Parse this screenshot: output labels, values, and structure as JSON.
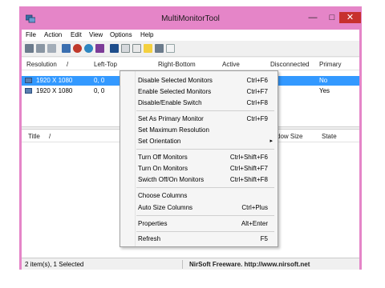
{
  "window": {
    "title": "MultiMonitorTool",
    "accent": "#e585c8",
    "controls": [
      "—",
      "□",
      "✕"
    ]
  },
  "menu": [
    "File",
    "Action",
    "Edit",
    "View",
    "Options",
    "Help"
  ],
  "table": {
    "headers": [
      "Resolution",
      "/",
      "Left-Top",
      "Right-Bottom",
      "Active",
      "Disconnected",
      "Primary"
    ],
    "rows": [
      {
        "resolution": "1920 X 1080",
        "left_top": "0, 0",
        "primary": "No",
        "selected": true
      },
      {
        "resolution": "1920 X 1080",
        "left_top": "0, 0",
        "primary": "Yes",
        "selected": false
      }
    ]
  },
  "lower_table": {
    "headers": [
      "Title",
      "/",
      "dow Size",
      "State"
    ]
  },
  "context_menu": {
    "items": [
      {
        "label": "Disable Selected Monitors",
        "key": "Ctrl+F6"
      },
      {
        "label": "Enable Selected Monitors",
        "key": "Ctrl+F7"
      },
      {
        "label": "Disable/Enable Switch",
        "key": "Ctrl+F8"
      },
      {
        "label": "Set As Primary Monitor",
        "key": "Ctrl+F9"
      },
      {
        "label": "Set Maximum Resolution",
        "key": ""
      },
      {
        "label": "Set Orientation",
        "key": ""
      },
      {
        "label": "Turn Off Monitors",
        "key": "Ctrl+Shift+F6"
      },
      {
        "label": "Turn On Monitors",
        "key": "Ctrl+Shift+F7"
      },
      {
        "label": "Swicth Off/On Monitors",
        "key": "Ctrl+Shift+F8"
      },
      {
        "label": "Choose Columns",
        "key": ""
      },
      {
        "label": "Auto Size Columns",
        "key": "Ctrl+Plus"
      },
      {
        "label": "Properties",
        "key": "Alt+Enter"
      },
      {
        "label": "Refresh",
        "key": "F5"
      }
    ],
    "submenu_arrow": "▸"
  },
  "status": {
    "left": "2 item(s), 1 Selected",
    "right": "NirSoft Freeware.  http://www.nirsoft.net"
  }
}
